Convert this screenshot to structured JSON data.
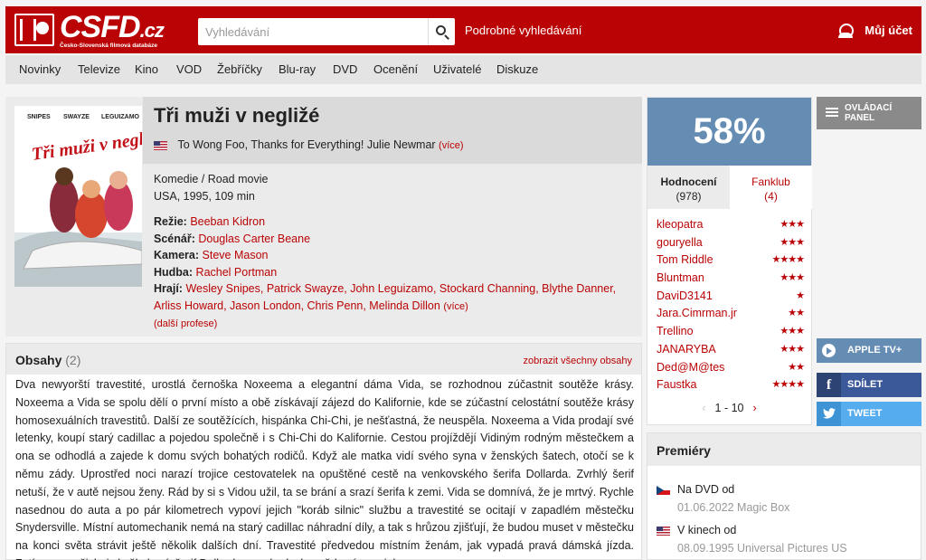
{
  "header": {
    "logo_text": "CSFD",
    "logo_tld": ".cz",
    "logo_subtitle": "Česko-Slovenská filmová databáze",
    "search_placeholder": "Vyhledávání",
    "advanced_search": "Podrobné vyhledávání",
    "account": "Můj účet",
    "brand_color": "#ba0305"
  },
  "nav": [
    "Novinky",
    "Televize",
    "Kino",
    "VOD",
    "Žebříčky",
    "Blu-ray",
    "DVD",
    "Ocenění",
    "Uživatelé",
    "Diskuze"
  ],
  "film": {
    "poster_names": [
      "SNIPES",
      "SWAYZE",
      "LEGUIZAMO"
    ],
    "poster_title": "Tři muži v negližé",
    "title": "Tři muži v negližé",
    "alt_title": "To Wong Foo, Thanks for Everything! Julie Newmar",
    "alt_more": "(více)",
    "genre": "Komedie / Road movie",
    "origin": "USA, 1995, 109 min",
    "director_label": "Režie:",
    "director": "Beeban Kidron",
    "writer_label": "Scénář:",
    "writer": "Douglas Carter Beane",
    "camera_label": "Kamera:",
    "camera": "Steve Mason",
    "music_label": "Hudba:",
    "music": "Rachel Portman",
    "cast_label": "Hrají:",
    "cast_line1": "Wesley Snipes, Patrick Swayze, John Leguizamo, Stockard Channing, Blythe Danner,",
    "cast_line2": "Arliss Howard, Jason London, Chris Penn, Melinda Dillon",
    "cast_more": "(více)",
    "more_professions": "(další profese)"
  },
  "plot": {
    "title": "Obsahy",
    "count": "(2)",
    "show_all": "zobrazit všechny obsahy",
    "text": "Dva newyorští travestité, urostlá černoška Noxeema a elegantní dáma Vida, se rozhodnou zúčastnit soutěže krásy. Noxeema a Vida se spolu dělí o první místo a obě získávají zájezd do Kalifornie, kde se zúčastní celostátní soutěže krásy homosexuálních travestitů. Další ze soutěžících, hispánka Chi-Chi, je nešťastná, že neuspěla. Noxeema a Vida prodají své letenky, koupí starý cadillac a pojedou společně i s Chi-Chi do Kalifornie. Cestou projíždějí Vidiným rodným městečkem a ona se odhodlá a zajede k domu svých bohatých rodičů. Když ale matka vidí svého syna v ženských šatech, otočí se k němu zády. Uprostřed noci narazí trojice cestovatelek na opuštěné cestě na venkovského šerifa Dollarda. Zvrhlý šerif netuší, že v autě nejsou ženy. Rád by si s Vidou užil, ta se brání a srazí šerifa k zemi. Vida se domnívá, že je mrtvý. Rychle nasednou do auta a po pár kilometrech vypoví jejich \"koráb silnic\" službu a travestité se ocitají v zapadlém městečku Snydersville. Místní automechanik nemá na starý cadillac náhradní díly, a tak s hrůzou zjišťují, že budou muset v městečku na konci světa strávit ještě několik dalších dní. Travestité předvedou místním ženám, jak vypadá pravá dámská jízda. Zatímco se všichni skvěle baví, šerif Dollard se probral z bezvědomí a rozjel"
  },
  "rating": {
    "percent": "58%",
    "box_color": "#658db4",
    "tab_ratings": "Hodnocení",
    "tab_ratings_count": "(978)",
    "tab_fanclub": "Fanklub",
    "tab_fanclub_count": "(4)",
    "raters": [
      {
        "name": "kleopatra",
        "stars": "★★★",
        "value": 3
      },
      {
        "name": "gouryella",
        "stars": "★★★",
        "value": 3
      },
      {
        "name": "Tom Riddle",
        "stars": "★★★★",
        "value": 4
      },
      {
        "name": "Bluntman",
        "stars": "★★★",
        "value": 3
      },
      {
        "name": "DaviD3141",
        "stars": "★",
        "value": 1
      },
      {
        "name": "Jara.Cimrman.jr",
        "stars": "★★",
        "value": 2
      },
      {
        "name": "Trellino",
        "stars": "★★★",
        "value": 3
      },
      {
        "name": "JANARYBA",
        "stars": "★★★",
        "value": 3
      },
      {
        "name": "Ded@M@tes",
        "stars": "★★",
        "value": 2
      },
      {
        "name": "Faustka",
        "stars": "★★★★",
        "value": 4
      }
    ],
    "pager": "1 - 10"
  },
  "side": {
    "panel": [
      "OVLÁDACÍ",
      "PANEL"
    ],
    "apple_tv": "APPLE TV+",
    "share": "SDÍLET",
    "tweet": "TWEET"
  },
  "premieres": {
    "title": "Premiéry",
    "items": [
      {
        "label": "Na DVD od",
        "detail": "01.06.2022 Magic Box",
        "flag": "cz"
      },
      {
        "label": "V kinech od",
        "detail": "08.09.1995 Universal Pictures US",
        "flag": "us"
      }
    ]
  }
}
